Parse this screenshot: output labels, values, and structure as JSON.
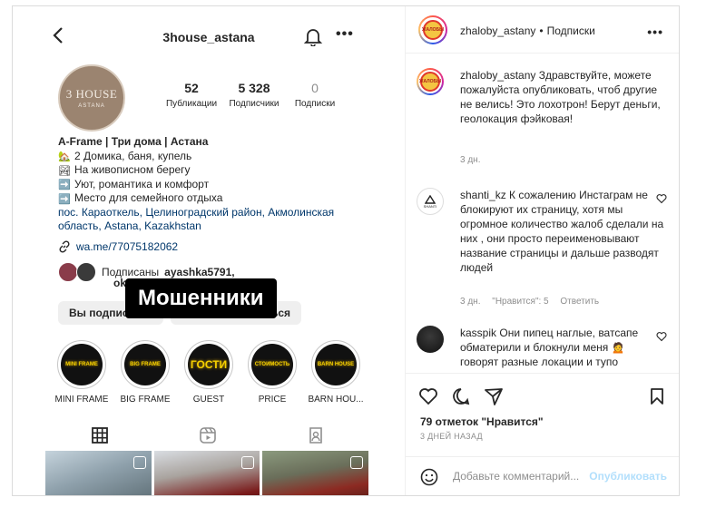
{
  "profile": {
    "username": "3house_astana",
    "avatar_text": "3 HOUSE",
    "avatar_subtext": "ASTANA",
    "stats": [
      {
        "value": "52",
        "label": "Публикации"
      },
      {
        "value": "5 328",
        "label": "Подписчики"
      },
      {
        "value": "0",
        "label": "Подписки"
      }
    ],
    "bio_name": "A-Frame | Три дома | Астана",
    "bio_lines": [
      {
        "emoji": "🏡",
        "text": "2 Домика, баня, купель"
      },
      {
        "emoji": "🏞",
        "text": "На живописном берегу"
      },
      {
        "emoji": "➡️",
        "text": "Уют, романтика и комфорт"
      },
      {
        "emoji": "➡️",
        "text": "Место для семейного отдыха"
      }
    ],
    "address": "пос. Караоткель, Целиноградский район, Акмолинская область, Astana, Kazakhstan",
    "link": "wa.me/77075182062",
    "followed_by_prefix": "Подписаны ",
    "followed_by_user1": "ayashka5791,",
    "followed_by_user2": "ok",
    "buttons": [
      "Вы подпис",
      "язаться"
    ],
    "overlay_text": "Мошенники",
    "highlights": [
      {
        "label": "MINI FRAME",
        "cover": "MINI FRAME"
      },
      {
        "label": "BIG FRAME",
        "cover": "BIG FRAME"
      },
      {
        "label": "GUEST",
        "cover": "ГОСТИ"
      },
      {
        "label": "PRICE",
        "cover": "СТОИМОСТЬ"
      },
      {
        "label": "BARN HOU...",
        "cover": "BARN HOUSE"
      }
    ]
  },
  "post": {
    "author": "zhaloby_astany",
    "separator": "•",
    "follow_state": "Подписки",
    "avatar_text": "ЖАЛОБЫ",
    "comments": [
      {
        "user": "zhaloby_astany",
        "text": "Здравствуйте, можете пожалуйста опубликовать, чтоб другие не велись! Это лохотрон! Берут деньги, геолокация фэйковая!",
        "time": "3 дн."
      },
      {
        "user": "shanti_kz",
        "avatar_text": "SHANTI",
        "text": "К сожалению Инстаграм не блокируют их страницу, хотя мы огромное количество жалоб сделали на них , они просто переименовывают название страницы и дальше разводят людей",
        "time": "3 дн.",
        "likes": "\"Нравится\": 5",
        "reply": "Ответить"
      },
      {
        "user": "kasspik",
        "text": "Они пипец наглые, ватсапе обматерили и блокнули меня 🙍 говорят разные локации и тупо",
        "time": ""
      }
    ],
    "likes_count": "79 отметок \"Нравится\"",
    "date": "3 ДНЕЙ НАЗАД",
    "comment_placeholder": "Добавьте комментарий...",
    "publish_label": "Опубликовать"
  }
}
